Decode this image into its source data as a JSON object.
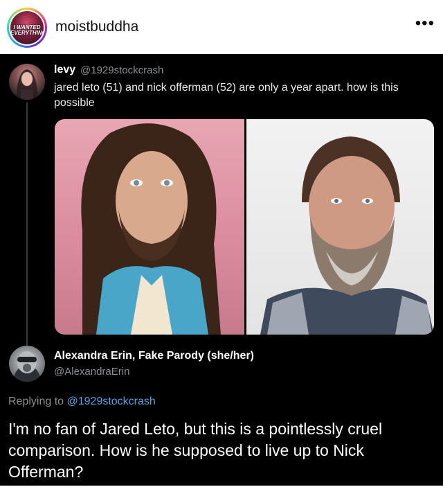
{
  "post": {
    "username": "moistbuddha",
    "avatar_text": "I WANTED EVERYTHING",
    "more_icon": "more-horizontal-icon"
  },
  "tweet": {
    "author_name": "levy",
    "author_handle": "@1929stockcrash",
    "text": "jared leto (51) and nick offerman (52) are only a year apart. how is this possible"
  },
  "reply": {
    "author_name": "Alexandra Erin, Fake Parody (she/her)",
    "author_handle": "@AlexandraErin",
    "replying_prefix": "Replying to",
    "replying_handle": "@1929stockcrash",
    "text": "I'm no fan of Jared Leto, but this is a pointlessly cruel comparison. How is he supposed to live up to Nick Offerman?"
  },
  "colors": {
    "background": "#000000",
    "text": "#ffffff",
    "muted": "#8a8f94",
    "link": "#4aa3e8"
  }
}
